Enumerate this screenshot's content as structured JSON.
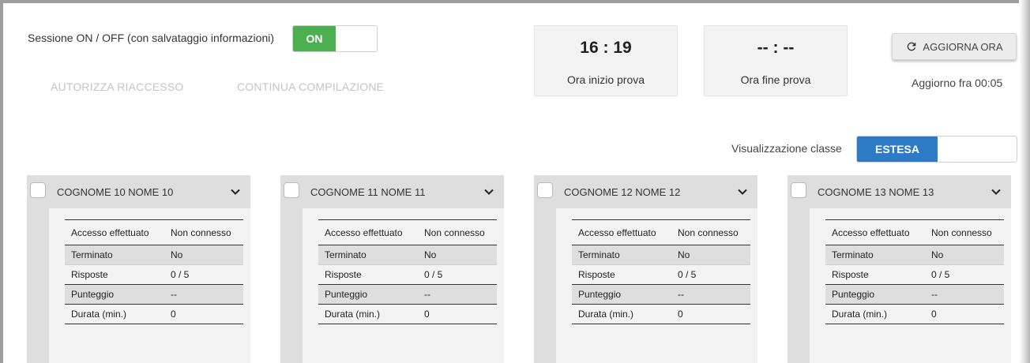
{
  "session": {
    "label": "Sessione ON / OFF (con salvataggio informazioni)",
    "toggle_state": "ON"
  },
  "actions": {
    "authorize_reaccess": "AUTORIZZA RIACCESSO",
    "continue_compilation": "CONTINUA COMPILAZIONE"
  },
  "times": {
    "start_value": "16 : 19",
    "start_label": "Ora inizio prova",
    "end_value": "-- : --",
    "end_label": "Ora fine prova"
  },
  "refresh": {
    "label": "AGGIORNA ORA",
    "icon": "refresh-icon",
    "countdown": "Aggiorno fra 00:05"
  },
  "view": {
    "label": "Visualizzazione classe",
    "selected": "ESTESA"
  },
  "students": [
    {
      "name": "COGNOME 10 NOME 10",
      "rows": [
        {
          "key": "Accesso effettuato",
          "value": "Non connesso"
        },
        {
          "key": "Terminato",
          "value": "No"
        },
        {
          "key": "Risposte",
          "value": "0 / 5"
        },
        {
          "key": "Punteggio",
          "value": "--"
        },
        {
          "key": "Durata (min.)",
          "value": "0"
        }
      ]
    },
    {
      "name": "COGNOME 11 NOME 11",
      "rows": [
        {
          "key": "Accesso effettuato",
          "value": "Non connesso"
        },
        {
          "key": "Terminato",
          "value": "No"
        },
        {
          "key": "Risposte",
          "value": "0 / 5"
        },
        {
          "key": "Punteggio",
          "value": "--"
        },
        {
          "key": "Durata (min.)",
          "value": "0"
        }
      ]
    },
    {
      "name": "COGNOME 12 NOME 12",
      "rows": [
        {
          "key": "Accesso effettuato",
          "value": "Non connesso"
        },
        {
          "key": "Terminato",
          "value": "No"
        },
        {
          "key": "Risposte",
          "value": "0 / 5"
        },
        {
          "key": "Punteggio",
          "value": "--"
        },
        {
          "key": "Durata (min.)",
          "value": "0"
        }
      ]
    },
    {
      "name": "COGNOME 13 NOME 13",
      "rows": [
        {
          "key": "Accesso effettuato",
          "value": "Non connesso"
        },
        {
          "key": "Terminato",
          "value": "No"
        },
        {
          "key": "Risposte",
          "value": "0 / 5"
        },
        {
          "key": "Punteggio",
          "value": "--"
        },
        {
          "key": "Durata (min.)",
          "value": "0"
        }
      ]
    }
  ],
  "colors": {
    "toggle_on": "#4caf50",
    "view_selected": "#2e7bc5",
    "disabled_text": "#c4c4c4",
    "card_bg": "#dedede"
  }
}
